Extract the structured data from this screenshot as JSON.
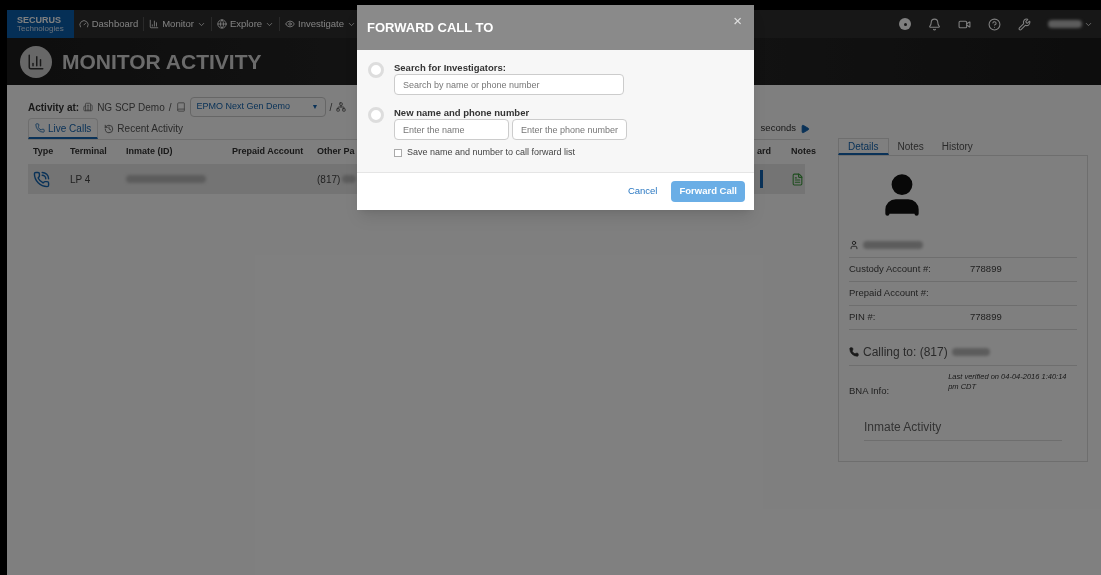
{
  "nav": {
    "logo": {
      "name": "SECURUS",
      "sub": "Technologies"
    },
    "items": [
      {
        "label": "Dashboard",
        "dropdown": false
      },
      {
        "label": "Monitor",
        "dropdown": true
      },
      {
        "label": "Explore",
        "dropdown": true
      },
      {
        "label": "Investigate",
        "dropdown": true
      }
    ]
  },
  "banner": {
    "title": "MONITOR ACTIVITY"
  },
  "activity": {
    "label": "Activity at:",
    "site": "NG SCP Demo",
    "separators": [
      "/",
      "/"
    ],
    "facility": "EPMO Next Gen Demo",
    "caret": "▼"
  },
  "view_tabs": [
    {
      "label": "Live Calls",
      "selected": true
    },
    {
      "label": "Recent Activity",
      "selected": false
    }
  ],
  "refresh": {
    "label": "seconds"
  },
  "table": {
    "columns": [
      "Type",
      "Terminal",
      "Inmate (ID)",
      "Prepaid Account",
      "Other Pa",
      "ard",
      "Notes"
    ],
    "rows": [
      {
        "terminal": "LP 4",
        "other_party": "(817)",
        "selected": true
      }
    ]
  },
  "details": {
    "tabs": [
      {
        "label": "Details",
        "selected": true
      },
      {
        "label": "Notes",
        "selected": false
      },
      {
        "label": "History",
        "selected": false
      }
    ],
    "fields": [
      {
        "label": "Custody Account #:",
        "value": "778899"
      },
      {
        "label": "Prepaid Account #:"
      },
      {
        "label": "PIN #:",
        "value": "778899"
      }
    ],
    "calling": "Calling to: (817)",
    "bna": {
      "label": "BNA Info:",
      "note": "Last verified on 04-04-2016 1:40:14 pm CDT"
    },
    "section": "Inmate Activity"
  },
  "modal": {
    "title": "FORWARD CALL TO",
    "close": "×",
    "options": [
      {
        "kind": "search",
        "label": "Search for Investigators:",
        "selected": false,
        "fields": [
          {
            "placeholder": "Search by name or phone number"
          }
        ]
      },
      {
        "kind": "new",
        "label": "New name and phone number",
        "selected": false,
        "fields": [
          {
            "placeholder": "Enter the name"
          },
          {
            "placeholder": "Enter the phone number"
          }
        ]
      }
    ],
    "checkbox": {
      "label": "Save name and number to call forward list",
      "checked": false
    },
    "buttons": {
      "cancel": "Cancel",
      "submit": "Forward Call"
    }
  }
}
